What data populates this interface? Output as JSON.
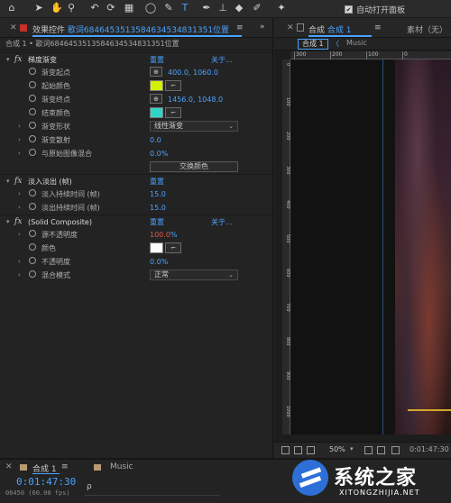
{
  "toolbar": {
    "auto_open_label": "自动打开面板",
    "auto_open_checked": "✔",
    "tools": [
      {
        "icon": "home-icon",
        "glyph": "⌂"
      },
      {
        "icon": "selection-arrow-icon",
        "glyph": "➤"
      },
      {
        "icon": "hand-icon",
        "glyph": "✋"
      },
      {
        "icon": "zoom-icon",
        "glyph": "⚲"
      },
      {
        "icon": "rotate-icon",
        "glyph": "↶"
      },
      {
        "icon": "camera-orbit-icon",
        "glyph": "⟳"
      },
      {
        "icon": "pan-behind-icon",
        "glyph": "▦"
      },
      {
        "icon": "ellipse-icon",
        "glyph": "◯"
      },
      {
        "icon": "pen-icon",
        "glyph": "✎"
      },
      {
        "icon": "type-icon",
        "glyph": "T"
      },
      {
        "icon": "brush-icon",
        "glyph": "✒"
      },
      {
        "icon": "clone-stamp-icon",
        "glyph": "⊥"
      },
      {
        "icon": "eraser-icon",
        "glyph": "◆"
      },
      {
        "icon": "roto-brush-icon",
        "glyph": "✐"
      },
      {
        "icon": "puppet-pin-icon",
        "glyph": "✦"
      }
    ]
  },
  "effect_controls": {
    "tab_title_prefix": "效果控件",
    "tab_layer_name": "歌词6846453513584634534831351位置",
    "menu_glyph": "≡",
    "chevron_glyph": "»",
    "breadcrumb": "合成 1 • 歌词6846453513584634534831351位置",
    "effects": [
      {
        "name": "梯度渐变",
        "reset": "重置",
        "about": "关于...",
        "params": [
          {
            "name": "渐变起点",
            "kind": "point",
            "value": "400.0, 1060.0"
          },
          {
            "name": "起始颜色",
            "kind": "color",
            "color": "#d4f000"
          },
          {
            "name": "渐变终点",
            "kind": "point",
            "value": "1456.0, 1048.0"
          },
          {
            "name": "结束颜色",
            "kind": "color",
            "color": "#2fd6c8"
          },
          {
            "name": "渐变形状",
            "kind": "dropdown",
            "value": "线性渐变"
          },
          {
            "name": "渐变散射",
            "kind": "number",
            "value": "0.0"
          },
          {
            "name": "与原始图像混合",
            "kind": "number",
            "value": "0.0%"
          },
          {
            "name": "",
            "kind": "button",
            "value": "交换颜色"
          }
        ]
      },
      {
        "name": "淡入淡出 (帧)",
        "reset": "重置",
        "about": "",
        "params": [
          {
            "name": "淡入持续时间 (帧)",
            "kind": "number",
            "value": "15.0"
          },
          {
            "name": "淡出持续时间 (帧)",
            "kind": "number",
            "value": "15.0"
          }
        ]
      },
      {
        "name": "(Solid Composite)",
        "reset": "重置",
        "about": "关于...",
        "params": [
          {
            "name": "源不透明度",
            "kind": "number-red",
            "value": "100.0",
            "unit": "%"
          },
          {
            "name": "颜色",
            "kind": "color",
            "color": "#ffffff"
          },
          {
            "name": "不透明度",
            "kind": "number",
            "value": "0.0%"
          },
          {
            "name": "混合模式",
            "kind": "dropdown",
            "value": "正常"
          }
        ]
      }
    ]
  },
  "composition": {
    "tab_title_prefix": "合成",
    "tab_comp_name": "合成 1",
    "menu_glyph": "≡",
    "material_label": "素材（无）",
    "subtab_active": "合成 1",
    "subtab_arrow": "〈",
    "subtab_other": "Music",
    "ruler_top_labels": [
      "300",
      "200",
      "100",
      "0"
    ],
    "ruler_left_labels": [
      "0",
      "100",
      "200",
      "300",
      "400",
      "500",
      "600",
      "700",
      "800",
      "900",
      "1000"
    ],
    "zoom": "50%",
    "time": "0:01:47:30"
  },
  "timeline": {
    "tab1_label": "合成 1",
    "tab1_menu": "≡",
    "tab2_label": "Music",
    "timecode": "0:01:47:30",
    "frame_info": "06450 (60.00 fps)",
    "search_glyph": "ρ"
  },
  "watermark": {
    "cn": "系统之家",
    "en": "XITONGZHIJIA.NET"
  },
  "colors": {
    "accent": "#4aa3ff",
    "panel_bg": "#232323",
    "alert_red": "#e0574b"
  }
}
